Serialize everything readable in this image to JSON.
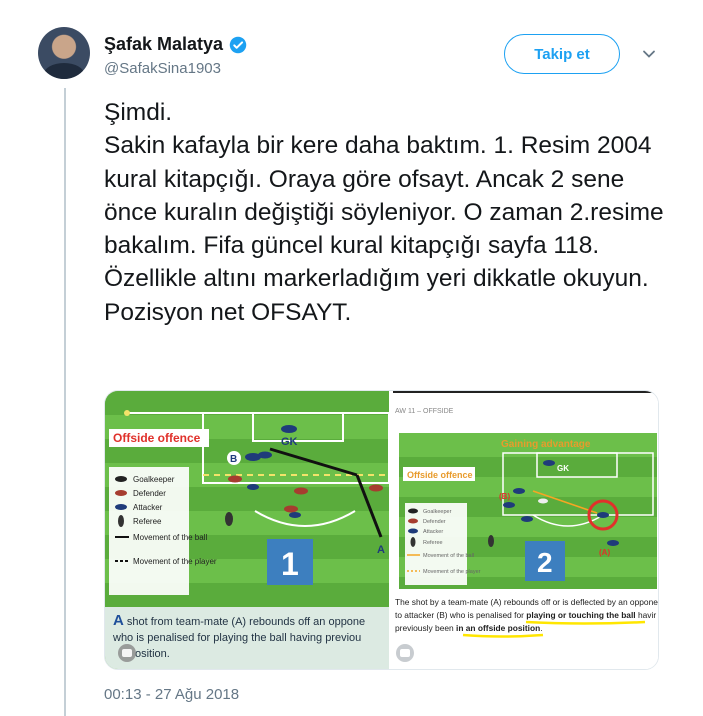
{
  "user": {
    "display_name": "Şafak Malatya",
    "handle": "@SafakSina1903"
  },
  "follow_label": "Takip et",
  "tweet_text": "Şimdi.\nSakin kafayla bir kere daha baktım. 1. Resim 2004 kural kitapçığı. Oraya göre ofsayt. Ancak 2 sene önce kuralın değiştiği söyleniyor. O zaman 2.resime bakalım. Fifa güncel kural kitapçığı sayfa 118. Özellikle altını markerladığım yeri dikkatle okuyun. Pozisyon net OFSAYT.",
  "timestamp": "00:13 - 27 Ağu 2018",
  "media": {
    "left": {
      "heading": "Offside offence",
      "gk_label": "GK",
      "b_label": "B",
      "a_label": "A",
      "number": "1",
      "legend": [
        "Goalkeeper",
        "Defender",
        "Attacker",
        "Referee",
        "Movement of the ball",
        "Movement of the player"
      ],
      "caption_lead": "A",
      "caption": " shot from team-mate (A) rebounds off an oppone",
      "caption_line2": "who is penalised for playing the ball having previou",
      "caption_line3": "osition."
    },
    "right": {
      "header": "AW 11 – OFFSIDE",
      "number_small": "13",
      "title": "Gaining advantage",
      "heading": "Offside offence",
      "gk_label": "GK",
      "b_label": "(B)",
      "a_label": "(A)",
      "number": "2",
      "legend": [
        "Goalkeeper",
        "Defender",
        "Attacker",
        "Referee",
        "Movement of the ball",
        "Movement of the player"
      ],
      "caption_line1": "The shot by a team-mate (A) rebounds off or is deflected by an oppone",
      "caption_line2_pre": "to attacker (B) who is penalised for ",
      "caption_line2_bold": "playing or touching the ball",
      "caption_line2_post": " havir",
      "caption_line3_pre": "previously been ",
      "caption_line3_bold": "in an offside position",
      "caption_line3_post": "."
    }
  },
  "colors": {
    "accent": "#1da1f2",
    "pitch": "#6cbf4a",
    "pitch_dark": "#5aac3c",
    "heading_red": "#e0312b",
    "number_blue": "#3d7fbf",
    "highlight": "#ffe600"
  }
}
